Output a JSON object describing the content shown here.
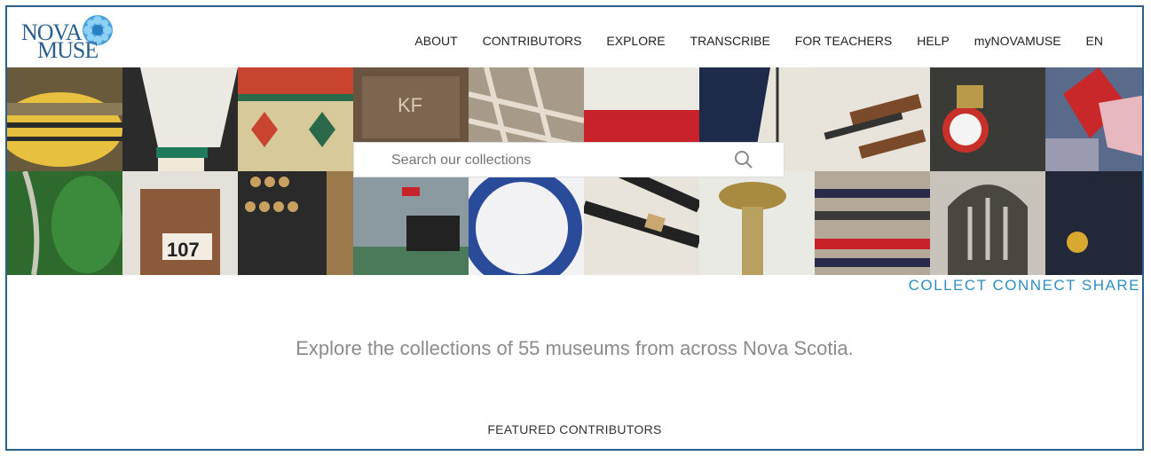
{
  "logo": {
    "line1": "NOVA",
    "line2": "MUSE"
  },
  "nav": [
    "ABOUT",
    "CONTRIBUTORS",
    "EXPLORE",
    "TRANSCRIBE",
    "FOR TEACHERS",
    "HELP",
    "myNOVAMUSE",
    "EN"
  ],
  "search": {
    "placeholder": "Search our collections"
  },
  "tagline": "COLLECT CONNECT SHARE",
  "intro": "Explore the collections of 55 museums from across Nova Scotia.",
  "featured_heading": "FEATURED CONTRIBUTORS",
  "colors": {
    "brand_blue": "#2a5f8e",
    "tagline_blue": "#2f8fc2",
    "frame_border": "#2b5f8a"
  },
  "banner_images": [
    "yellow-bowl",
    "shuttlecock",
    "quilted-pattern",
    "wooden-crate",
    "woven-basket",
    "red-white-paint",
    "ship-sail",
    "ice-skates",
    "miners-lamp",
    "patchwork-quilt",
    "green-garment",
    "oil-can-107",
    "abacus",
    "ship-painting",
    "blue-plate",
    "handles",
    "brass-candlestick",
    "striped-rug",
    "iron-grate",
    "button-jacket"
  ]
}
